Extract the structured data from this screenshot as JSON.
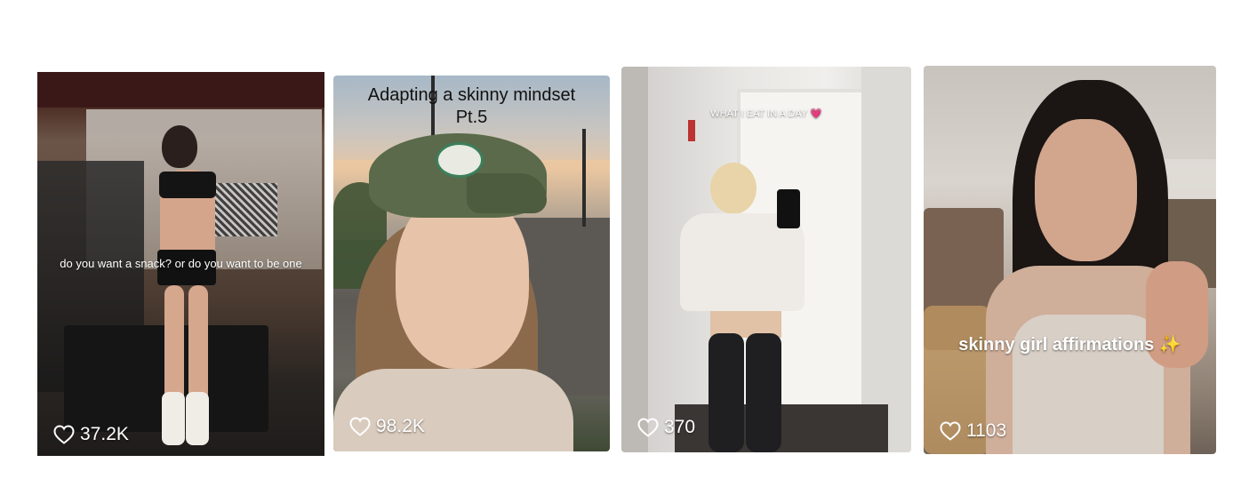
{
  "cards": [
    {
      "caption": "do you want a snack? or do you want to be one",
      "likes": "37.2K"
    },
    {
      "caption_line1": "Adapting a skinny mindset",
      "caption_line2": "Pt.5",
      "likes": "98.2K"
    },
    {
      "caption": "WHAT I EAT IN A DAY",
      "caption_emoji": "💗",
      "likes": "370"
    },
    {
      "caption": "skinny girl affirmations",
      "caption_emoji": "✨",
      "likes": "1103"
    }
  ],
  "colors": {
    "card_text": "#ffffff",
    "caption_dark": "#111111",
    "page_bg": "#ffffff"
  },
  "icons": {
    "likes": "heart-outline-icon"
  }
}
